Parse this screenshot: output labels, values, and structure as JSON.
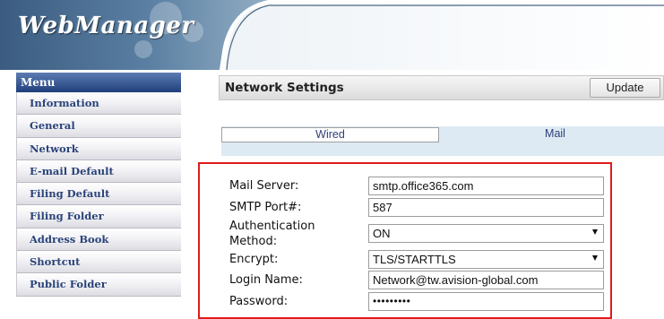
{
  "app": {
    "logo_text": "WebManager"
  },
  "sidebar": {
    "menu_title": "Menu",
    "items": [
      {
        "label": "Information"
      },
      {
        "label": "General"
      },
      {
        "label": "Network"
      },
      {
        "label": "E-mail Default"
      },
      {
        "label": "Filing Default"
      },
      {
        "label": "Filing Folder"
      },
      {
        "label": "Address Book"
      },
      {
        "label": "Shortcut"
      },
      {
        "label": "Public Folder"
      }
    ]
  },
  "header": {
    "title": "Network Settings",
    "update_label": "Update"
  },
  "tabs": [
    {
      "label": "Wired",
      "active": false
    },
    {
      "label": "Mail",
      "active": true
    }
  ],
  "form": {
    "mail_server": {
      "label": "Mail Server:",
      "value": "smtp.office365.com"
    },
    "smtp_port": {
      "label": "SMTP Port#:",
      "value": "587"
    },
    "auth_method": {
      "label_line1": "Authentication",
      "label_line2": "Method:",
      "value": "ON"
    },
    "encrypt": {
      "label": "Encrypt:",
      "value": "TLS/STARTTLS"
    },
    "login_name": {
      "label": "Login Name:",
      "value": "Network@tw.avision-global.com"
    },
    "password": {
      "label": "Password:",
      "value": "•••••••••"
    }
  },
  "colors": {
    "banner_dark": "#47678a",
    "menu_header": "#1f3f7c",
    "menu_text": "#2a4378",
    "tab_strip": "#ddeaf3",
    "highlight": "#e01b1b"
  }
}
